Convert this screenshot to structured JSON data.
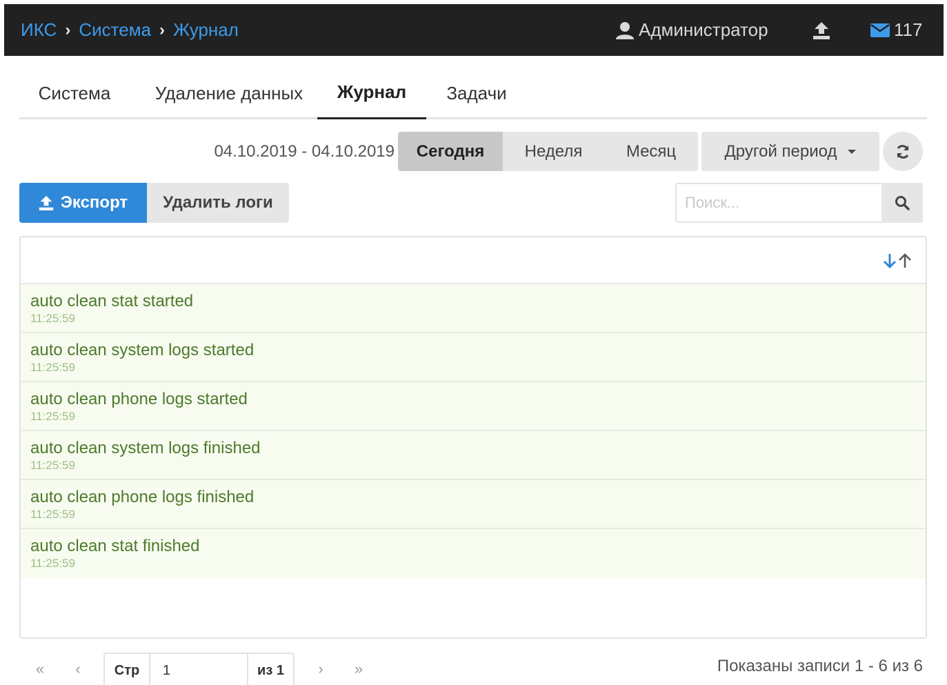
{
  "topbar": {
    "breadcrumb": [
      "ИКС",
      "Система",
      "Журнал"
    ],
    "user_name": "Администратор",
    "mail_count": "117",
    "colors": {
      "background": "#212121",
      "link": "#3d9bea"
    }
  },
  "tabs": [
    {
      "label": "Система"
    },
    {
      "label": "Удаление данных"
    },
    {
      "label": "Журнал",
      "active": true
    },
    {
      "label": "Задачи"
    }
  ],
  "period": {
    "date_range": "04.10.2019 - 04.10.2019",
    "buttons": [
      {
        "label": "Сегодня",
        "active": true
      },
      {
        "label": "Неделя"
      },
      {
        "label": "Месяц"
      }
    ],
    "other_label": "Другой период",
    "refresh_icon": "refresh-icon"
  },
  "actions": {
    "export_label": "Экспорт",
    "delete_label": "Удалить логи",
    "export_color": "#2f88d8"
  },
  "search": {
    "placeholder": "Поиск..."
  },
  "logs": [
    {
      "message": "auto clean stat started",
      "time": "11:25:59"
    },
    {
      "message": "auto clean system logs started",
      "time": "11:25:59"
    },
    {
      "message": "auto clean phone logs started",
      "time": "11:25:59"
    },
    {
      "message": "auto clean system logs finished",
      "time": "11:25:59"
    },
    {
      "message": "auto clean phone logs finished",
      "time": "11:25:59"
    },
    {
      "message": "auto clean stat finished",
      "time": "11:25:59"
    }
  ],
  "pager": {
    "first": "«",
    "prev": "‹",
    "page_label": "Стр",
    "page_value": "1",
    "of_label": "из 1",
    "next": "›",
    "last": "»",
    "records": "Показаны записи 1 - 6 из 6"
  }
}
